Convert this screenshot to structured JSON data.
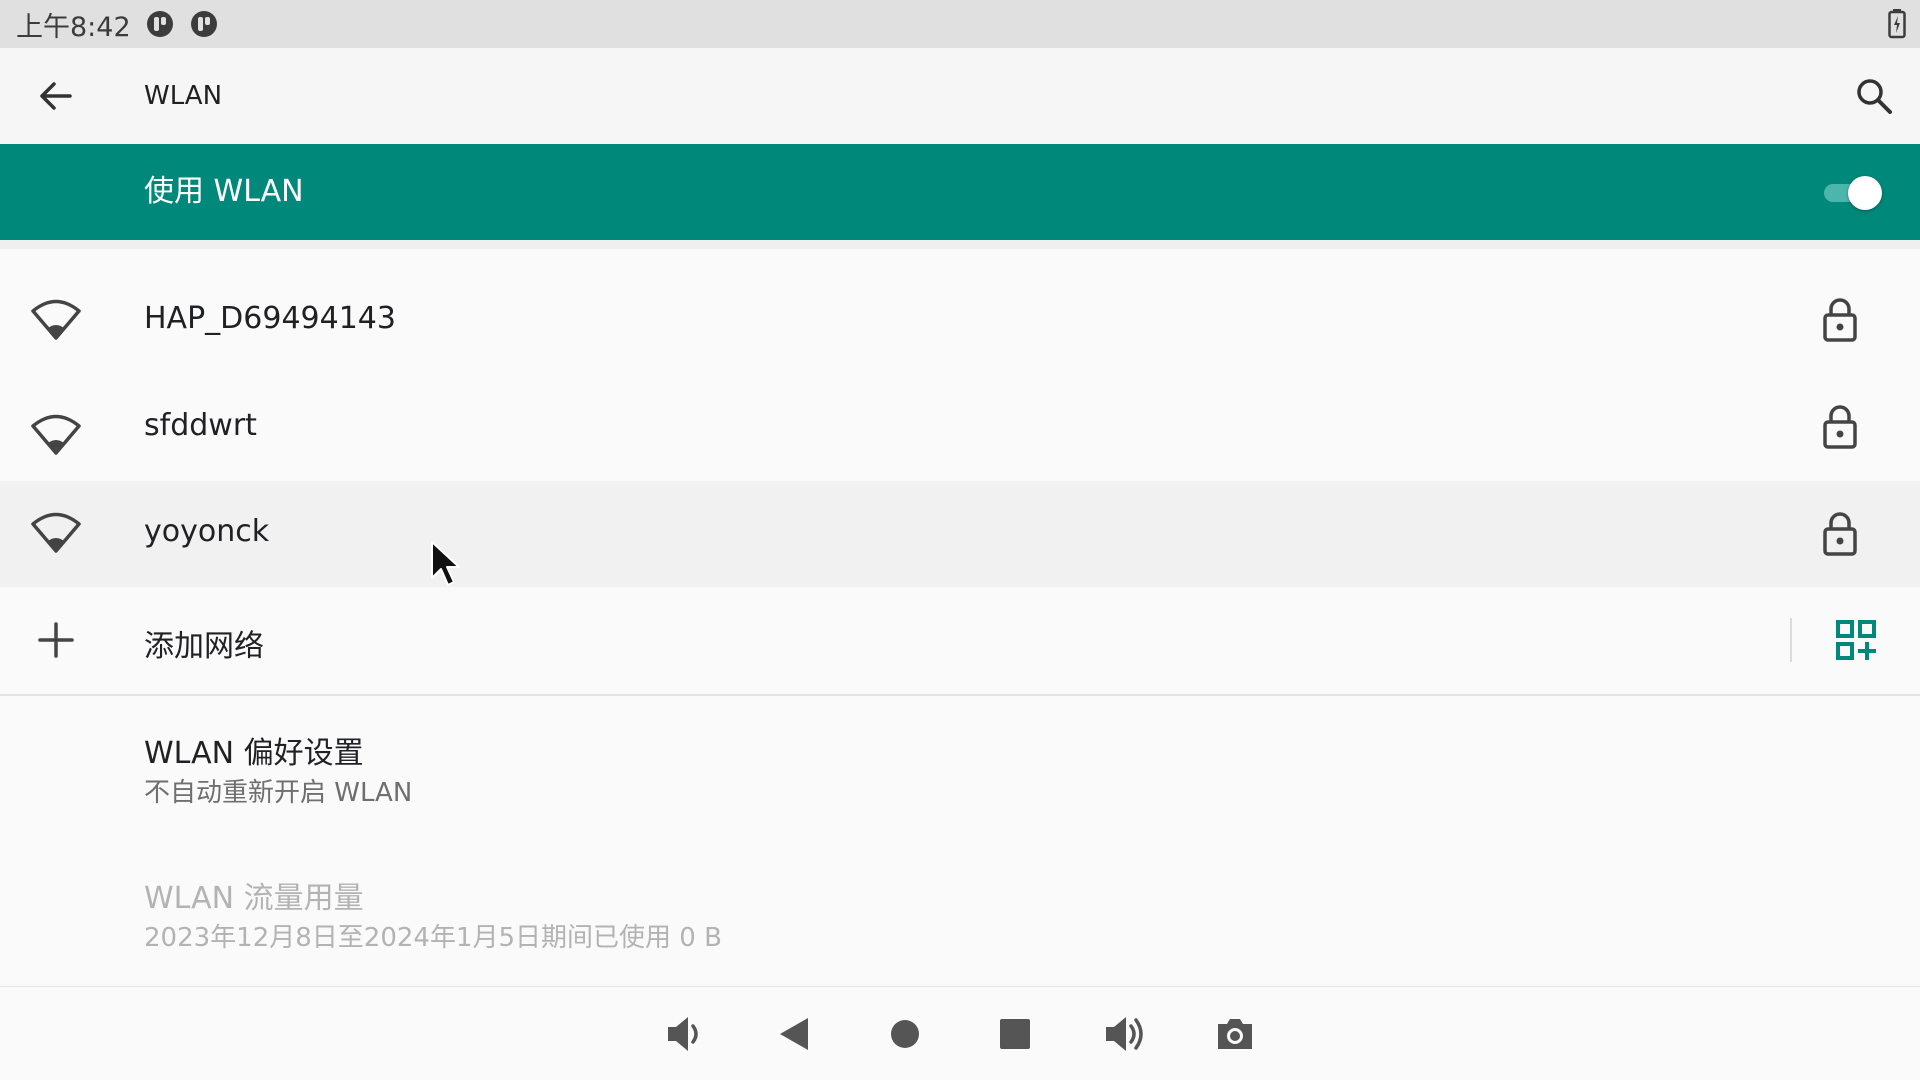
{
  "status_bar": {
    "time": "上午8:42",
    "notification_icons": [
      "notification-app-icon",
      "notification-app-icon"
    ],
    "battery_icon": "battery-charging-icon"
  },
  "app_bar": {
    "title": "WLAN",
    "back_icon": "arrow-back-icon",
    "search_icon": "search-icon"
  },
  "master_switch": {
    "label": "使用 WLAN",
    "enabled": true,
    "background_color": "#00897b"
  },
  "networks": [
    {
      "ssid": "HAP_D69494143",
      "secured": true,
      "signal_icon": "wifi-signal-icon",
      "lock_icon": "lock-icon"
    },
    {
      "ssid": "sfddwrt",
      "secured": true,
      "signal_icon": "wifi-signal-icon",
      "lock_icon": "lock-icon"
    },
    {
      "ssid": "yoyonck",
      "secured": true,
      "signal_icon": "wifi-signal-icon",
      "lock_icon": "lock-icon"
    }
  ],
  "add_network": {
    "label": "添加网络",
    "icon": "plus-icon",
    "qr_icon": "qr-code-scan-icon",
    "accent_color": "#00897b"
  },
  "preferences": {
    "title": "WLAN 偏好设置",
    "summary": "不自动重新开启 WLAN"
  },
  "data_usage": {
    "title": "WLAN 流量用量",
    "summary": "2023年12月8日至2024年1月5日期间已使用 0 B"
  },
  "nav_bar": {
    "buttons": [
      "volume-down-icon",
      "back-triangle-icon",
      "home-circle-icon",
      "recents-square-icon",
      "volume-up-icon",
      "camera-screenshot-icon"
    ]
  }
}
